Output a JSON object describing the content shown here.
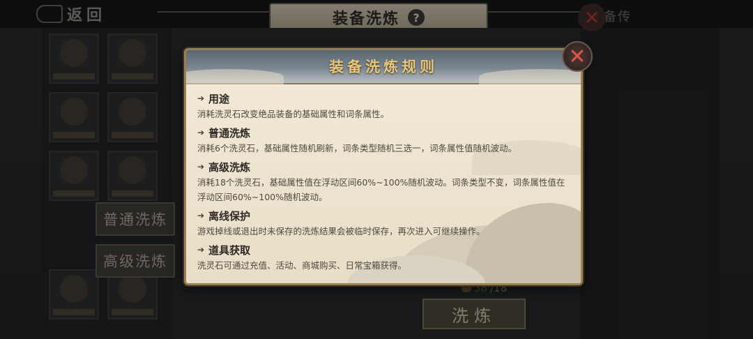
{
  "background": {
    "back_label": "返回",
    "screen_title": "装备洗炼",
    "help_glyph": "?",
    "right_label": "备传",
    "tabs": [
      "普通洗炼",
      "高级洗炼"
    ],
    "stone_have": "38",
    "stone_sep_need": "/18",
    "refine_label": "洗炼",
    "close_glyph": "✕",
    "colors": {
      "have": "#5d7a2e"
    }
  },
  "modal": {
    "title": "装备洗炼规则",
    "close_glyph": "✕",
    "sections": [
      {
        "title": "用途",
        "text": "消耗洗灵石改变绝品装备的基础属性和词条属性。"
      },
      {
        "title": "普通洗炼",
        "text": "消耗6个洗灵石，基础属性随机刷新，词条类型随机三选一，词条属性值随机波动。"
      },
      {
        "title": "高级洗炼",
        "text": "消耗18个洗灵石，基础属性值在浮动区间60%~100%随机波动。词条类型不变，词条属性值在浮动区间60%~100%随机波动。"
      },
      {
        "title": "离线保护",
        "text": "游戏掉线或退出时未保存的洗炼结果会被临时保存，再次进入可继续操作。"
      },
      {
        "title": "道具获取",
        "text": "洗灵石可通过充值、活动、商城购买、日常宝箱获得。"
      }
    ],
    "colors": {
      "title": "#e9c77a",
      "border": "#9a7f55",
      "close": "#e8524a"
    }
  }
}
